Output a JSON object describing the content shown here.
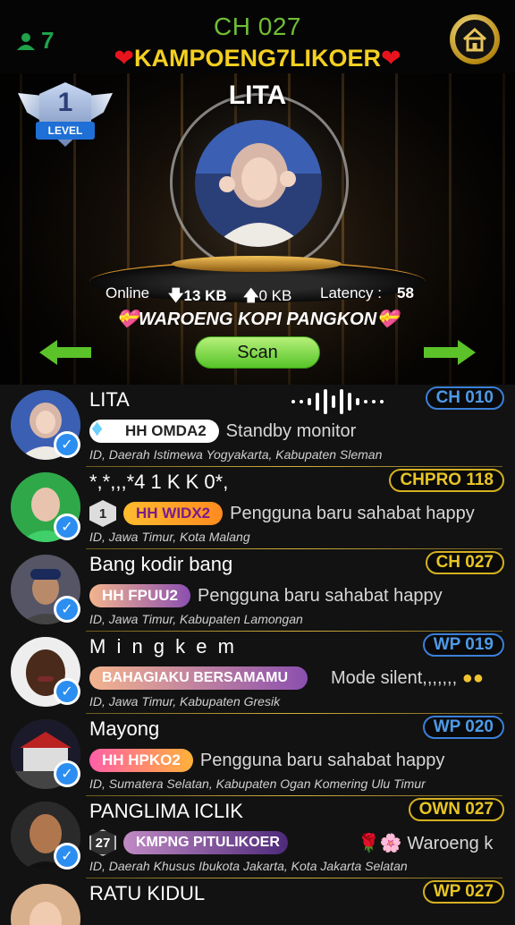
{
  "header": {
    "channel": "CH 027",
    "room_name": "KAMPOENG7LIKOER",
    "heart_symbol": "❤",
    "online_count": "7",
    "accent_color": "#6fbf36"
  },
  "stage": {
    "level_number": "1",
    "level_label": "LEVEL",
    "host_name": "LITA",
    "online_label": "Online",
    "download": "13 KB",
    "upload": "0 KB",
    "latency_label": "Latency :",
    "latency_value": "58",
    "room_title": "WAROENG KOPI PANGKON",
    "scan_label": "Scan"
  },
  "users": [
    {
      "name": "LITA",
      "channel": "CH 010",
      "channel_style": "blue",
      "tag": "HH OMDA2",
      "status": "Standby monitor",
      "location": "ID, Daerah Istimewa Yogyakarta, Kabupaten Sleman"
    },
    {
      "name": "*,*,,,*4 1 K K 0*,",
      "channel": "CHPRO 118",
      "channel_style": "gold",
      "level": "1",
      "tag": "HH WIDX2",
      "status": "Pengguna baru sahabat happy",
      "location": "ID, Jawa Timur, Kota Malang"
    },
    {
      "name": "Bang kodir bang",
      "channel": "CH 027",
      "channel_style": "gold",
      "tag": "HH FPUU2",
      "status": "Pengguna baru sahabat happy",
      "location": "ID, Jawa Timur, Kabupaten Lamongan"
    },
    {
      "name": "M i n g k e m",
      "channel": "WP 019",
      "channel_style": "blue",
      "tag": "BAHAGIAKU BERSAMAMU",
      "status": "Mode silent,,,,,,,",
      "location": "ID, Jawa Timur, Kabupaten Gresik"
    },
    {
      "name": "Mayong",
      "channel": "WP 020",
      "channel_style": "blue",
      "tag": "HH HPKO2",
      "status": "Pengguna baru sahabat happy",
      "location": "ID, Sumatera Selatan, Kabupaten Ogan Komering Ulu Timur"
    },
    {
      "name": "PANGLIMA ICLIK",
      "channel": "OWN 027",
      "channel_style": "gold",
      "level": "27",
      "tag": "KMPNG PITULIKOER",
      "status": "🌹🌸 Waroeng k",
      "location": "ID, Daerah Khusus Ibukota Jakarta, Kota Jakarta Selatan"
    },
    {
      "name": "RATU KIDUL",
      "channel": "WP 027",
      "channel_style": "gold"
    }
  ]
}
